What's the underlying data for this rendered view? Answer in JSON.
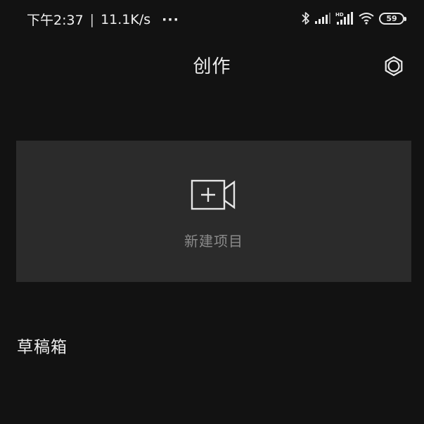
{
  "status_bar": {
    "time": "下午2:37",
    "separator": "|",
    "net_speed": "11.1K/s",
    "more": "···",
    "battery_level": "59",
    "icons": [
      "bluetooth-icon",
      "signal-icon",
      "hd-signal-icon",
      "wifi-icon",
      "battery-icon"
    ]
  },
  "header": {
    "title": "创作",
    "settings_icon": "gear-icon"
  },
  "new_project": {
    "label": "新建项目",
    "icon": "video-add-icon"
  },
  "drafts": {
    "title": "草稿箱"
  },
  "colors": {
    "background": "#121212",
    "card": "#2b2b2b",
    "text": "#ececec",
    "muted": "#8a8a8a"
  }
}
